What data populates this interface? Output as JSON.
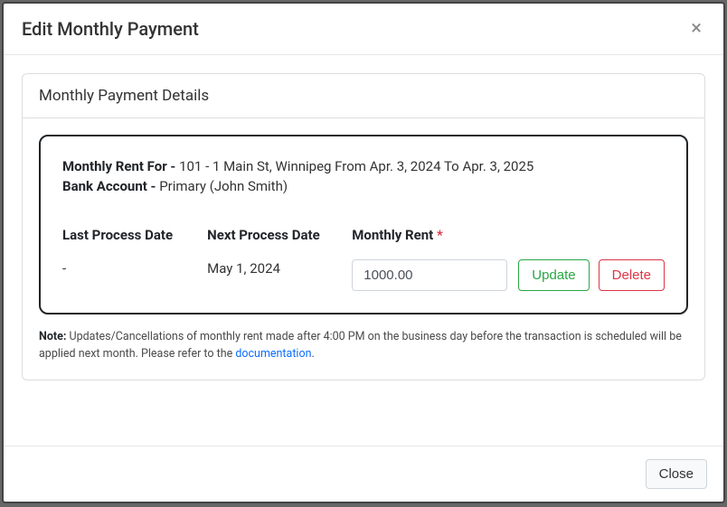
{
  "modal": {
    "title": "Edit Monthly Payment",
    "close_label": "Close"
  },
  "details": {
    "section_title": "Monthly Payment Details",
    "monthly_rent_for_label": "Monthly Rent For - ",
    "monthly_rent_for_value": "101 - 1 Main St, Winnipeg From Apr. 3, 2024 To Apr. 3, 2025",
    "bank_account_label": "Bank Account - ",
    "bank_account_value": "Primary (John Smith)",
    "fields": {
      "last_process_date": {
        "label": "Last Process Date",
        "value": "-"
      },
      "next_process_date": {
        "label": "Next Process Date",
        "value": "May 1, 2024"
      },
      "monthly_rent": {
        "label": "Monthly Rent ",
        "required_marker": "*",
        "value": "1000.00"
      }
    },
    "actions": {
      "update": "Update",
      "delete": "Delete"
    },
    "note": {
      "label": "Note: ",
      "text_before_link": "Updates/Cancellations of monthly rent made after 4:00 PM on the business day before the transaction is scheduled will be applied next month. Please refer to the ",
      "link_text": "documentation",
      "text_after_link": "."
    }
  }
}
